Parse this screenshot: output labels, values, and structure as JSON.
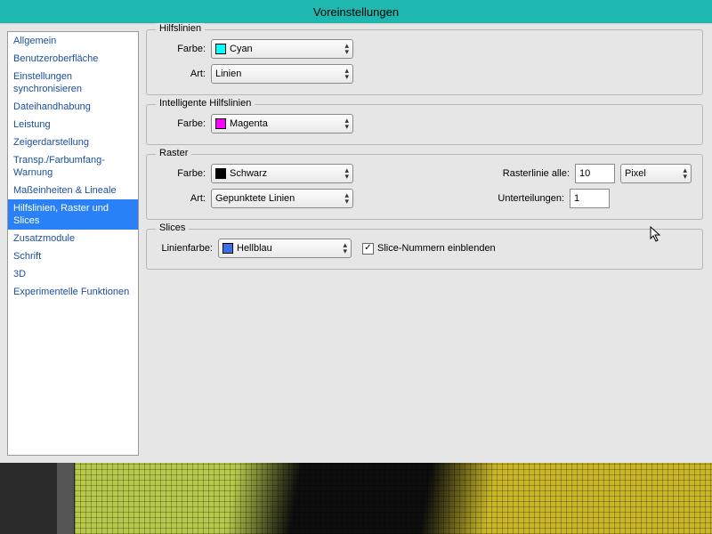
{
  "title": "Voreinstellungen",
  "sidebar": {
    "items": [
      {
        "label": "Allgemein"
      },
      {
        "label": "Benutzeroberfläche"
      },
      {
        "label": "Einstellungen synchronisieren"
      },
      {
        "label": "Dateihandhabung"
      },
      {
        "label": "Leistung"
      },
      {
        "label": "Zeigerdarstellung"
      },
      {
        "label": "Transp./Farbumfang-Warnung"
      },
      {
        "label": "Maßeinheiten & Lineale"
      },
      {
        "label": "Hilfslinien, Raster und Slices"
      },
      {
        "label": "Zusatzmodule"
      },
      {
        "label": "Schrift"
      },
      {
        "label": "3D"
      },
      {
        "label": "Experimentelle Funktionen"
      }
    ],
    "selected_index": 8
  },
  "groups": {
    "guides": {
      "legend": "Hilfslinien",
      "color_label": "Farbe:",
      "color_value": "Cyan",
      "color_swatch": "#00ffff",
      "style_label": "Art:",
      "style_value": "Linien"
    },
    "smart_guides": {
      "legend": "Intelligente Hilfslinien",
      "color_label": "Farbe:",
      "color_value": "Magenta",
      "color_swatch": "#ff00ff"
    },
    "grid": {
      "legend": "Raster",
      "color_label": "Farbe:",
      "color_value": "Schwarz",
      "color_swatch": "#000000",
      "style_label": "Art:",
      "style_value": "Gepunktete Linien",
      "every_label": "Rasterlinie alle:",
      "every_value": "10",
      "unit_value": "Pixel",
      "subdiv_label": "Unterteilungen:",
      "subdiv_value": "1"
    },
    "slices": {
      "legend": "Slices",
      "color_label": "Linienfarbe:",
      "color_value": "Hellblau",
      "color_swatch": "#3b6fe8",
      "show_numbers_label": "Slice-Nummern einblenden",
      "show_numbers_checked": true
    }
  }
}
